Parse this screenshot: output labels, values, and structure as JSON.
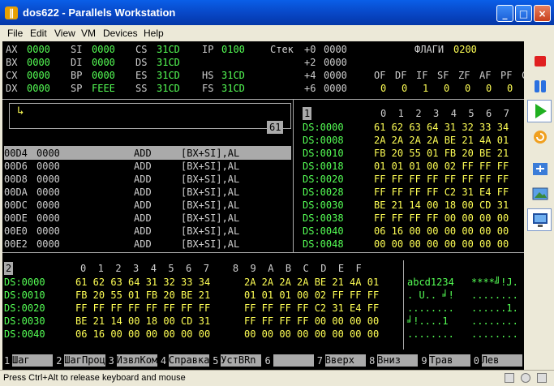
{
  "window": {
    "title": "dos622 - Parallels Workstation",
    "minimize": "_",
    "maximize": "□",
    "close": "×"
  },
  "menu": [
    "File",
    "Edit",
    "View",
    "VM",
    "Devices",
    "Help"
  ],
  "vm": {
    "regs": [
      [
        "AX",
        "0000",
        "SI",
        "0000",
        "CS",
        "31CD",
        "IP",
        "0100"
      ],
      [
        "BX",
        "0000",
        "DI",
        "0000",
        "DS",
        "31CD",
        "",
        ""
      ],
      [
        "CX",
        "0000",
        "BP",
        "0000",
        "ES",
        "31CD",
        "HS",
        "31CD"
      ],
      [
        "DX",
        "0000",
        "SP",
        "FEEE",
        "SS",
        "31CD",
        "FS",
        "31CD"
      ]
    ],
    "stack_label": "Стек",
    "stack": [
      [
        "+0",
        "0000"
      ],
      [
        "+2",
        "0000"
      ],
      [
        "+4",
        "0000"
      ],
      [
        "+6",
        "0000"
      ]
    ],
    "flags_label": "ФЛАГИ",
    "flags_value": "0200",
    "flag_names": [
      "OF",
      "DF",
      "IF",
      "SF",
      "ZF",
      "AF",
      "PF",
      "CF"
    ],
    "flag_values": [
      "0",
      "0",
      "1",
      "0",
      "0",
      "0",
      "0",
      "0"
    ],
    "code_arrow": "↳",
    "code_box_value": "61",
    "disasm": [
      [
        "00D4",
        "0000",
        "ADD",
        "[BX+SI],AL"
      ],
      [
        "00D6",
        "0000",
        "ADD",
        "[BX+SI],AL"
      ],
      [
        "00D8",
        "0000",
        "ADD",
        "[BX+SI],AL"
      ],
      [
        "00DA",
        "0000",
        "ADD",
        "[BX+SI],AL"
      ],
      [
        "00DC",
        "0000",
        "ADD",
        "[BX+SI],AL"
      ],
      [
        "00DE",
        "0000",
        "ADD",
        "[BX+SI],AL"
      ],
      [
        "00E0",
        "0000",
        "ADD",
        "[BX+SI],AL"
      ],
      [
        "00E2",
        "0000",
        "ADD",
        "[BX+SI],AL"
      ]
    ],
    "dump1_label": "1",
    "dump1_header": "0  1  2  3  4  5  6  7",
    "dump1_rows": [
      [
        "DS:0000",
        "61 62 63 64 31 32 33 34"
      ],
      [
        "DS:0008",
        "2A 2A 2A 2A BE 21 4A 01"
      ],
      [
        "DS:0010",
        "FB 20 55 01 FB 20 BE 21"
      ],
      [
        "DS:0018",
        "01 01 01 00 02 FF FF FF"
      ],
      [
        "DS:0020",
        "FF FF FF FF FF FF FF FF"
      ],
      [
        "DS:0028",
        "FF FF FF FF C2 31 E4 FF"
      ],
      [
        "DS:0030",
        "BE 21 14 00 18 00 CD 31"
      ],
      [
        "DS:0038",
        "FF FF FF FF 00 00 00 00"
      ],
      [
        "DS:0040",
        "06 16 00 00 00 00 00 00"
      ],
      [
        "DS:0048",
        "00 00 00 00 00 00 00 00"
      ]
    ],
    "dump2_label": "2",
    "dump2_header": "0  1  2  3  4  5  6  7    8  9  A  B  C  D  E  F",
    "dump2_rows": [
      [
        "DS:0000",
        "61 62 63 64 31 32 33 34",
        "2A 2A 2A 2A BE 21 4A 01"
      ],
      [
        "DS:0010",
        "FB 20 55 01 FB 20 BE 21",
        "01 01 01 00 02 FF FF FF"
      ],
      [
        "DS:0020",
        "FF FF FF FF FF FF FF FF",
        "FF FF FF FF C2 31 E4 FF"
      ],
      [
        "DS:0030",
        "BE 21 14 00 18 00 CD 31",
        "FF FF FF FF 00 00 00 00"
      ],
      [
        "DS:0040",
        "06 16 00 00 00 00 00 00",
        "00 00 00 00 00 00 00 00"
      ]
    ],
    "ascii_rows": [
      [
        "abcd1234",
        "****╝!J."
      ],
      [
        ". U.. ╛!",
        "........"
      ],
      [
        "........",
        "......1."
      ],
      [
        "╛!....1",
        "........"
      ],
      [
        "........",
        "........"
      ]
    ],
    "fkeys": [
      [
        "1",
        "Шаг"
      ],
      [
        "2",
        "ШагПроц"
      ],
      [
        "3",
        "ИзвлКом"
      ],
      [
        "4",
        "Справка"
      ],
      [
        "5",
        "УстBRn"
      ],
      [
        "6",
        ""
      ],
      [
        "7",
        "Вверх"
      ],
      [
        "8",
        "Вниз"
      ],
      [
        "9",
        "Трав"
      ],
      [
        "0",
        "Лев"
      ]
    ]
  },
  "status": {
    "text": "Press Ctrl+Alt to release keyboard and mouse"
  },
  "sidebar_icons": [
    "stop-icon",
    "pause-icon",
    "play-icon",
    "reset-icon",
    "fullscreen-icon",
    "screenshot-icon",
    "display-icon"
  ],
  "colors": {
    "title_bar": "#0A5FE8",
    "dos_green": "#55FF55",
    "dos_gray": "#AAAAAA",
    "dos_yellow": "#FFFF55"
  }
}
